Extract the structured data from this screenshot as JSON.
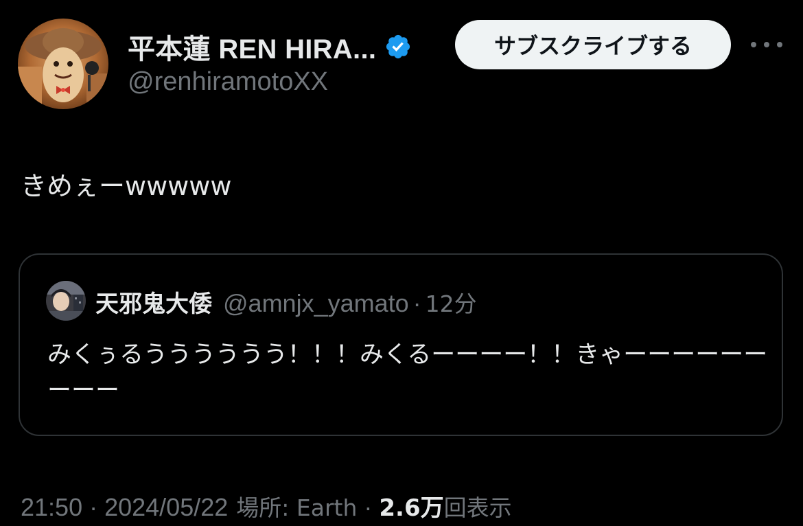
{
  "author": {
    "display_name": "平本蓮 REN HIRA...",
    "handle": "@renhiramotoXX",
    "verified_color": "#1d9bf0"
  },
  "subscribe_button": {
    "label": "サブスクライブする"
  },
  "more_icon": "more-horizontal-icon",
  "tweet": {
    "text": "きめぇーwwwww"
  },
  "quote": {
    "display_name": "天邪鬼大倭",
    "handle": "@amnjx_yamato",
    "separator": "·",
    "time": "12分",
    "text": "みくぅるうううううう！！！みくるーーーー！！きゃーーーーーーーーー"
  },
  "meta": {
    "time": "21:50",
    "sep1": "·",
    "date": "2024/05/22",
    "location_label": "場所: Earth",
    "sep2": "·",
    "views_count": "2.6万",
    "views_label": "回表示"
  },
  "colors": {
    "background": "#000000",
    "primary_text": "#e7e9ea",
    "secondary_text": "#71767b",
    "border": "#2f3336",
    "button_bg": "#eff3f4"
  }
}
